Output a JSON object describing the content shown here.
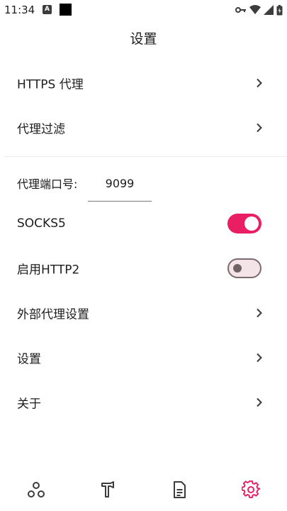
{
  "status_bar": {
    "time": "11:34",
    "badge_letter": "A"
  },
  "header": {
    "title": "设置"
  },
  "rows": {
    "https_proxy": "HTTPS 代理",
    "proxy_filter": "代理过滤",
    "port_label": "代理端口号:",
    "port_value": "9099",
    "socks5": "SOCKS5",
    "http2": "启用HTTP2",
    "external_proxy": "外部代理设置",
    "settings": "设置",
    "about": "关于"
  },
  "toggles": {
    "socks5_on": true,
    "http2_on": false
  },
  "colors": {
    "accent": "#e91e63",
    "toggle_off_track": "#f3e4e7",
    "toggle_off_border": "#7b6b70"
  },
  "bottom_nav": {
    "items": [
      {
        "icon": "network-nodes-icon",
        "active": false
      },
      {
        "icon": "hammer-icon",
        "active": false
      },
      {
        "icon": "document-icon",
        "active": false
      },
      {
        "icon": "gear-icon",
        "active": true
      }
    ]
  }
}
